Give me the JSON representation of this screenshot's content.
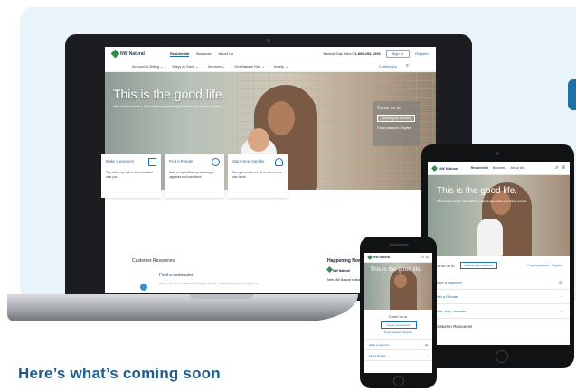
{
  "heading": "Here’s what’s coming soon",
  "laptop": {
    "brand": "NW Natural",
    "nav_primary": [
      "Residential",
      "Business",
      "About Us"
    ],
    "phone_prompt": "Natural Gas Odor?",
    "phone_number": "1-800-293-1093",
    "signin_label": "Sign In",
    "register_label": "Register",
    "subnav": [
      "Account & Billing ⌄",
      "Ways to Save ⌄",
      "Services ⌄",
      "Get Natural Gas ⌄",
      "Safety ⌄"
    ],
    "contact_label": "Contact Us",
    "hero_title": "This is the good life.",
    "hero_subtitle": "With instant comfort, high-efficiency natural gas makes your house a home.",
    "signin_box": {
      "title": "Come on in.",
      "access": "Access your account",
      "forgot": "Forgot password",
      "register": "Register"
    },
    "cards": [
      {
        "title": "Make a payment",
        "text": "Pay online, by mail, or find a location near you."
      },
      {
        "title": "Find a Rebate",
        "text": "Save on high-efficiency natural gas upgrades and insulations."
      },
      {
        "title": "Start, stop, transfer",
        "text": "Turn gas service on, off or move it to a new home."
      }
    ],
    "customer_resources": "Customer Resources",
    "happening_now": "Happening Now",
    "contractor_title": "Find a contractor",
    "contractor_text": "Our pre-screened, preferred contractors inspect, install and repair your equipment.",
    "news_brand": "NW Natural",
    "news_text": "New NW Natural customers get..."
  },
  "tablet": {
    "brand": "NW Natural",
    "nav": [
      "Residential",
      "Business",
      "About Us"
    ],
    "hero_title": "This is the good life.",
    "hero_subtitle": "With instant comfort, high-efficiency natural gas makes your house a home.",
    "come_on_in": "Come on in.",
    "access": "Access your account",
    "forgot": "Forgot password",
    "register": "Register",
    "rows": [
      "Make a payment",
      "Find a Rebate",
      "Start, stop, transfer"
    ],
    "customer_resources": "Customer Resources"
  },
  "phone": {
    "brand": "NW Natural",
    "hero_title": "This is the good life.",
    "come_on_in": "Come on in.",
    "access": "Access your account",
    "links": "Forgot password | Register",
    "rows": [
      "Make a payment",
      "Find a Rebate"
    ]
  }
}
